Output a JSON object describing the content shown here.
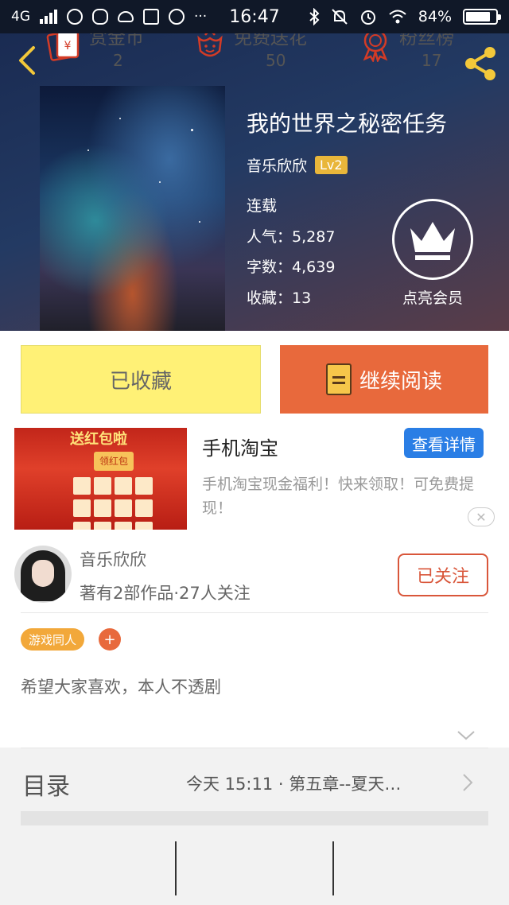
{
  "status_bar": {
    "network": "4G",
    "time": "16:47",
    "battery_text": "84%",
    "battery_level": 0.84,
    "icons": [
      "signal-icon",
      "browser-icon",
      "wechat-icon",
      "cloud-icon",
      "storage-icon",
      "paint-icon",
      "more-icon",
      "bluetooth-icon",
      "mute-icon",
      "alarm-icon",
      "wifi-icon",
      "battery-icon"
    ],
    "more": "···"
  },
  "book": {
    "title": "我的世界之秘密任务",
    "author": "音乐欣欣",
    "level": "Lv2",
    "status": "连载",
    "popularity_label": "人气：",
    "popularity": "5,287",
    "words_label": "字数：",
    "words": "4,639",
    "favorites_label": "收藏：",
    "favorites": "13",
    "vip_label": "点亮会员"
  },
  "actions": {
    "collected_label": "已收藏",
    "read_label": "继续阅读"
  },
  "ad": {
    "title": "手机淘宝",
    "detail_label": "查看详情",
    "description": "手机淘宝现金福利！快来领取！可免费提现！",
    "banner_text": "送红包啦",
    "hongbao_text": "领红包",
    "close_glyph": "✕"
  },
  "author_block": {
    "name": "音乐欣欣",
    "info": "著有2部作品·27人关注",
    "follow_label": "已关注"
  },
  "tags": {
    "items": [
      "游戏同人"
    ],
    "add_glyph": "+"
  },
  "intro": "希望大家喜欢，本人不透剧",
  "catalog": {
    "label": "目录",
    "latest": "今天 15:11 · 第五章--夏天…"
  },
  "bottom": [
    {
      "label": "赏金币",
      "value": "2",
      "icon": "coin-envelope-icon"
    },
    {
      "label": "免费送花",
      "value": "50",
      "icon": "flower-icon"
    },
    {
      "label": "粉丝榜",
      "value": "17",
      "icon": "medal-icon"
    }
  ],
  "colors": {
    "accent_orange": "#e8693c",
    "collect_yellow": "#fff176",
    "ad_blue": "#2a7ee5",
    "level_gold": "#e9b63a",
    "icon_red": "#d33b26"
  }
}
